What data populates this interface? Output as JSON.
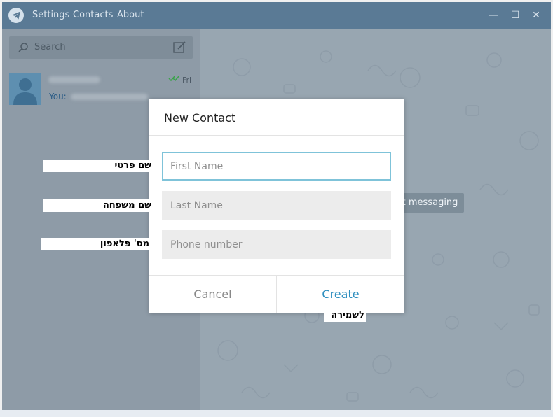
{
  "menu": {
    "settings": "Settings",
    "contacts": "Contacts",
    "about": "About"
  },
  "window_controls": {
    "minimize": "—",
    "maximize": "☐",
    "close": "✕"
  },
  "search": {
    "placeholder": "Search"
  },
  "chat": {
    "you_label": "You:",
    "time": "Fri"
  },
  "background_status": "Start messaging",
  "dialog": {
    "title": "New Contact",
    "first_name_placeholder": "First Name",
    "last_name_placeholder": "Last Name",
    "phone_placeholder": "Phone number",
    "cancel_label": "Cancel",
    "create_label": "Create"
  },
  "annotations": {
    "first_name": "שם פרטי",
    "last_name": "שם משפחה",
    "phone": "מס' פלאפון",
    "save": "לשמירה"
  },
  "colors": {
    "titlebar": "#5a7a95",
    "sidebar": "#8e9ba7",
    "chat_background": "#98a6b1",
    "accent": "#2f8fbf",
    "focus_border": "#7fc3d9"
  }
}
